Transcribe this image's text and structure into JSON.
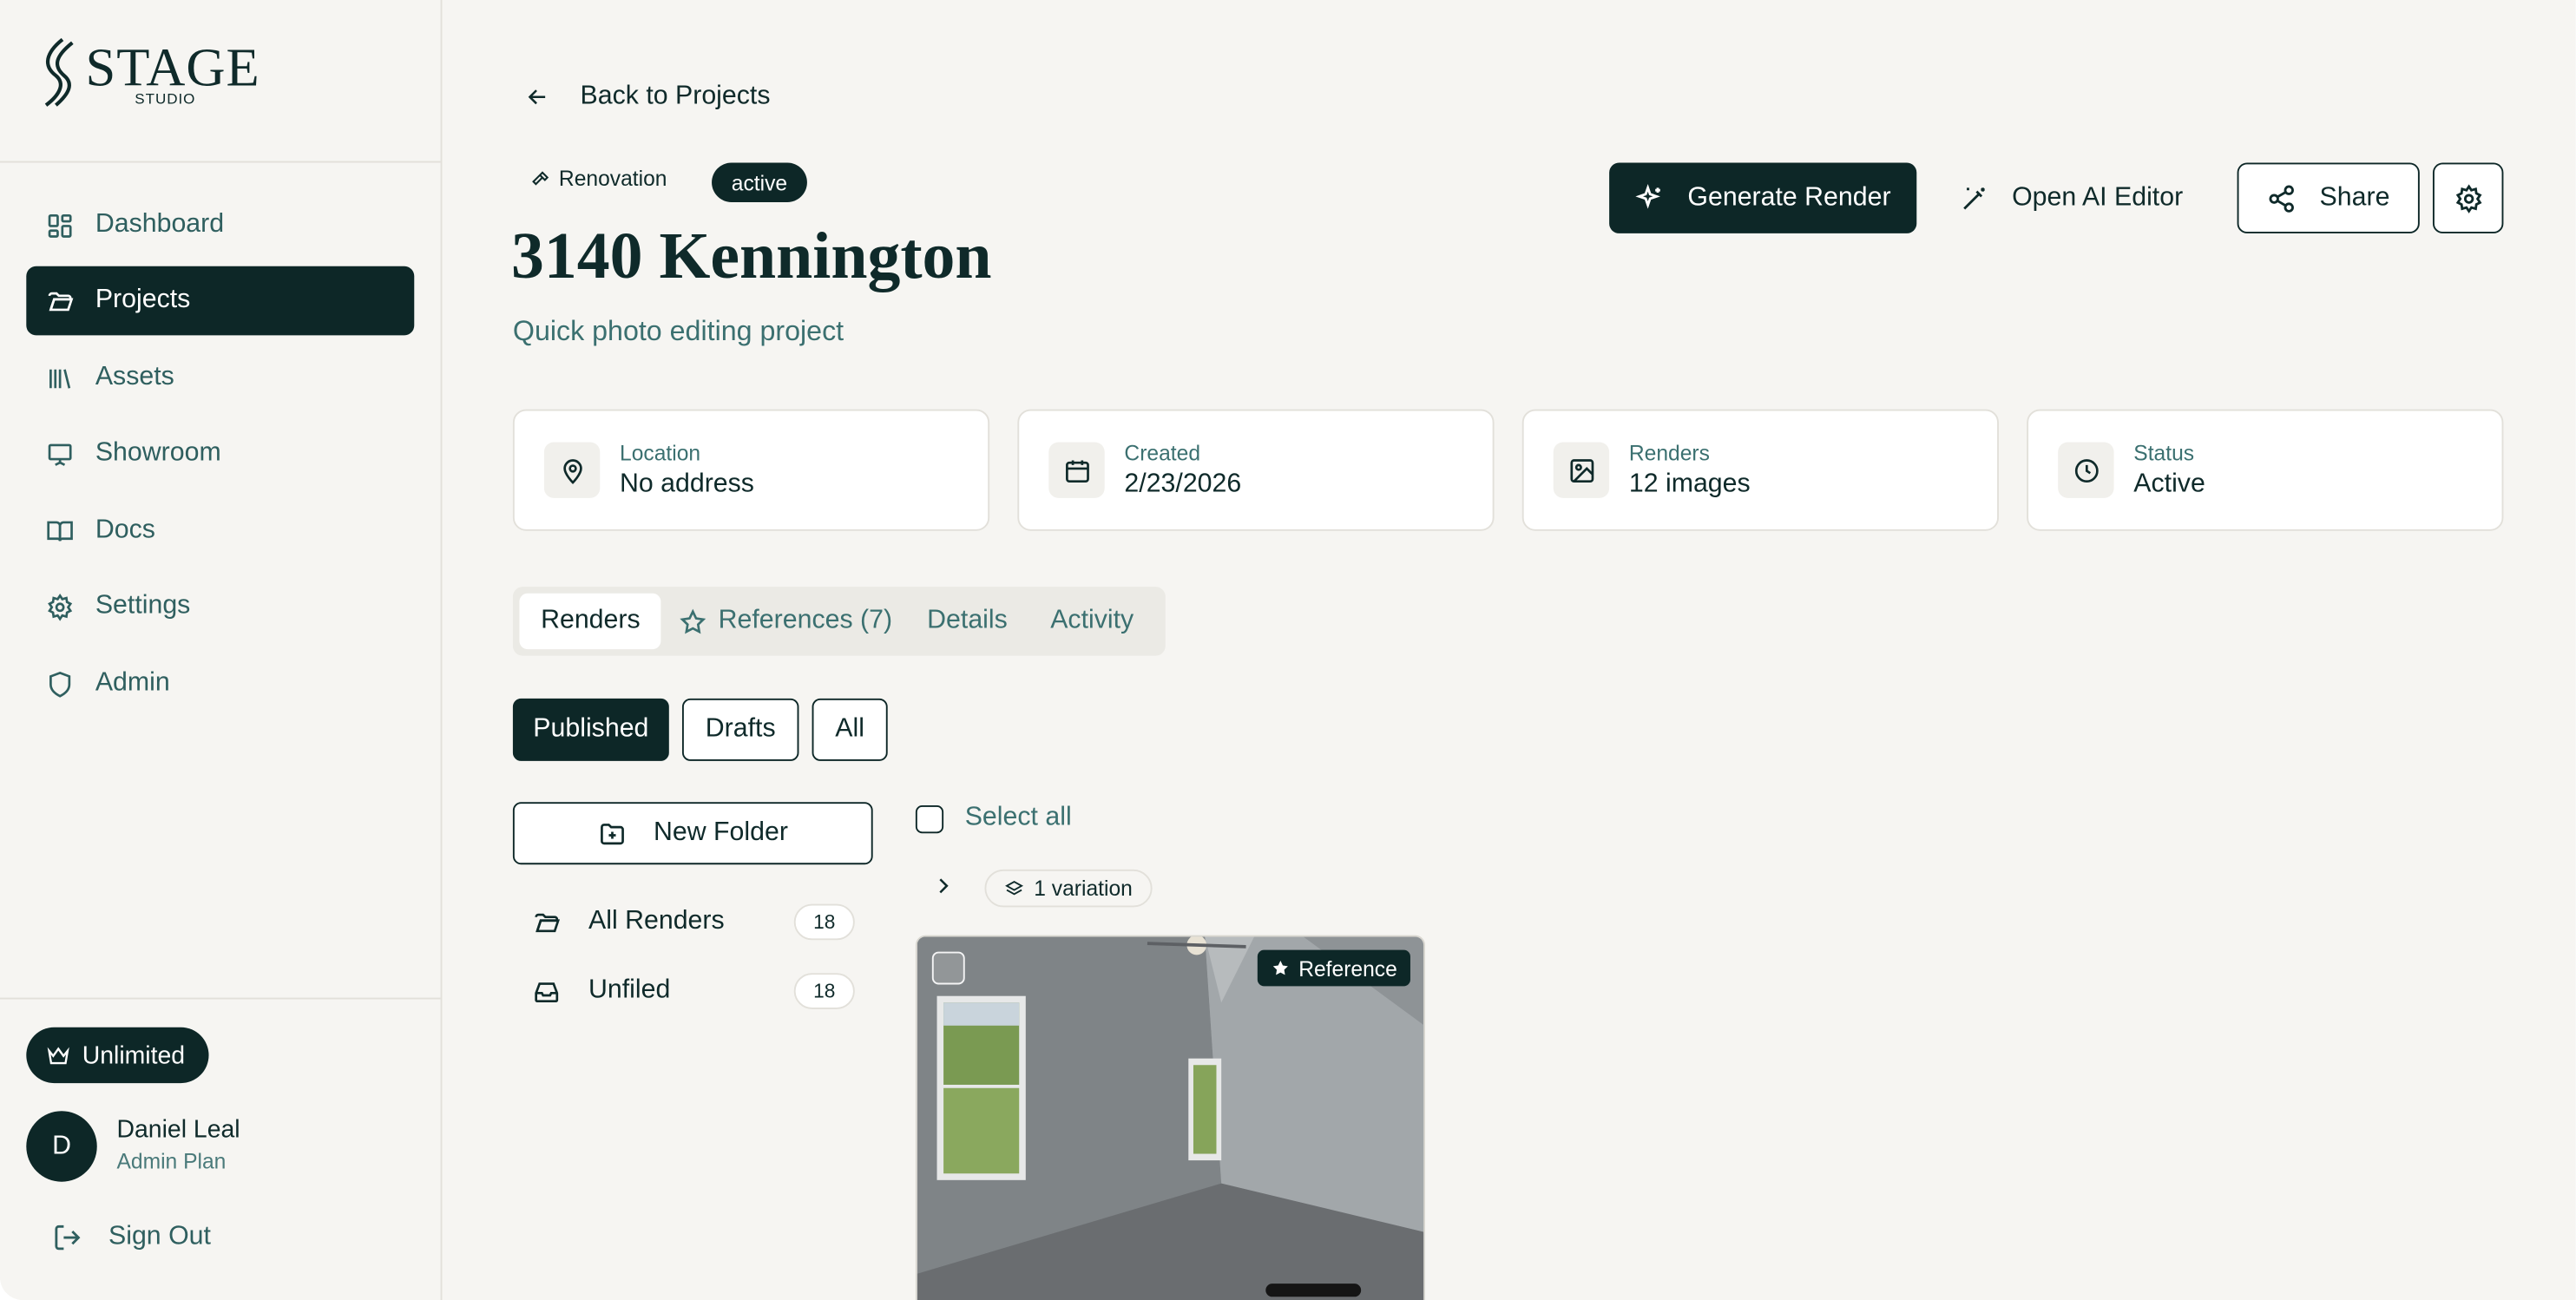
{
  "brand": {
    "logo_main": "STAGE",
    "logo_sub": "STUDIO"
  },
  "sidebar": {
    "items": [
      {
        "label": "Dashboard",
        "icon": "dashboard-icon"
      },
      {
        "label": "Projects",
        "icon": "folder-icon",
        "active": true
      },
      {
        "label": "Assets",
        "icon": "library-icon"
      },
      {
        "label": "Showroom",
        "icon": "presentation-icon"
      },
      {
        "label": "Docs",
        "icon": "book-icon"
      },
      {
        "label": "Settings",
        "icon": "gear-icon"
      },
      {
        "label": "Admin",
        "icon": "shield-icon"
      }
    ],
    "plan_badge": "Unlimited",
    "user": {
      "initial": "D",
      "name": "Daniel Leal",
      "plan": "Admin Plan"
    },
    "sign_out": "Sign Out"
  },
  "header": {
    "back_label": "Back to Projects",
    "type_tag": "Renovation",
    "status_tag": "active",
    "title": "3140 Kennington",
    "subtitle": "Quick photo editing project",
    "actions": {
      "generate": "Generate Render",
      "ai_editor": "Open AI Editor",
      "share": "Share"
    }
  },
  "stats": [
    {
      "label": "Location",
      "value": "No address",
      "icon": "map-pin-icon"
    },
    {
      "label": "Created",
      "value": "2/23/2026",
      "icon": "calendar-icon"
    },
    {
      "label": "Renders",
      "value": "12 images",
      "icon": "image-icon"
    },
    {
      "label": "Status",
      "value": "Active",
      "icon": "clock-icon"
    }
  ],
  "tabs": [
    {
      "label": "Renders",
      "active": true
    },
    {
      "label": "References (7)",
      "icon": "star-icon"
    },
    {
      "label": "Details"
    },
    {
      "label": "Activity"
    }
  ],
  "filters": [
    {
      "label": "Published",
      "active": true
    },
    {
      "label": "Drafts"
    },
    {
      "label": "All"
    }
  ],
  "folders": {
    "new_folder": "New Folder",
    "items": [
      {
        "label": "All Renders",
        "count": "18"
      },
      {
        "label": "Unfiled",
        "count": "18"
      }
    ]
  },
  "gallery": {
    "select_all": "Select all",
    "variation_label": "1 variation",
    "reference_badge": "Reference"
  },
  "colors": {
    "primary": "#0d2727",
    "background": "#f6f5f2",
    "accent_text": "#3b7070",
    "logo_accent": "#5aa8a8"
  }
}
